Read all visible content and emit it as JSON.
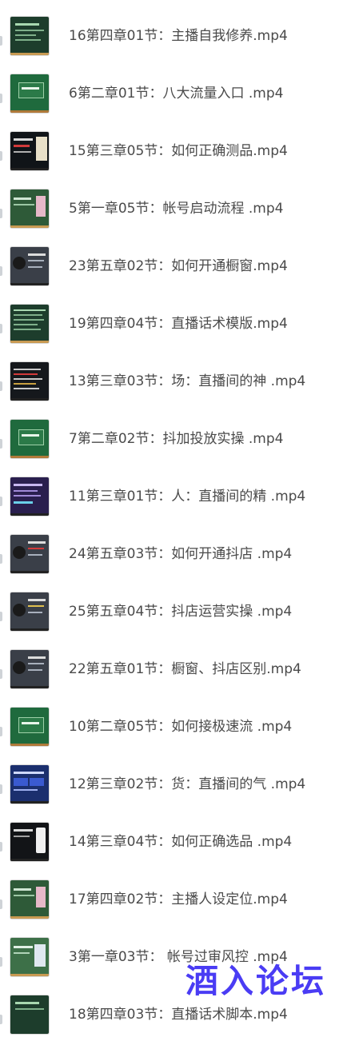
{
  "files": [
    {
      "name": "16第四章01节：主播自我修养.mp4",
      "thumb": "chalkboard"
    },
    {
      "name": "6第二章01节：八大流量入口 .mp4",
      "thumb": "green-board"
    },
    {
      "name": "15第三章05节：如何正确测品.mp4",
      "thumb": "dark-slide"
    },
    {
      "name": "5第一章05节：帐号启动流程 .mp4",
      "thumb": "board-photo"
    },
    {
      "name": "23第五章02节：如何开通橱窗.mp4",
      "thumb": "gray-slide"
    },
    {
      "name": "19第四章04节：直播话术模版.mp4",
      "thumb": "chalkboard"
    },
    {
      "name": "13第三章03节：场：直播间的神 .mp4",
      "thumb": "dark-text"
    },
    {
      "name": "7第二章02节：抖加投放实操 .mp4",
      "thumb": "green-board"
    },
    {
      "name": "11第三章01节：人：直播间的精 .mp4",
      "thumb": "purple-slide"
    },
    {
      "name": "24第五章03节：如何开通抖店 .mp4",
      "thumb": "gray-slide"
    },
    {
      "name": "25第五章04节：抖店运营实操 .mp4",
      "thumb": "gray-slide"
    },
    {
      "name": "22第五章01节：橱窗、抖店区别.mp4",
      "thumb": "gray-slide"
    },
    {
      "name": "10第二章05节：如何接极速流 .mp4",
      "thumb": "green-board"
    },
    {
      "name": "12第三章02节：货：直播间的气 .mp4",
      "thumb": "blue-slide"
    },
    {
      "name": "14第三章04节：如何正确选品 .mp4",
      "thumb": "dark-phone"
    },
    {
      "name": "17第四章02节：主播人设定位.mp4",
      "thumb": "board-photo"
    },
    {
      "name": "3第一章03节： 帐号过审风控 .mp4",
      "thumb": "green-light"
    },
    {
      "name": "18第四章03节：直播话术脚本.mp4",
      "thumb": "chalkboard"
    }
  ],
  "watermark": "酒入论坛",
  "colors": {
    "text": "#4a4a4a",
    "watermark": "#4a3cf4",
    "background": "#ffffff"
  }
}
